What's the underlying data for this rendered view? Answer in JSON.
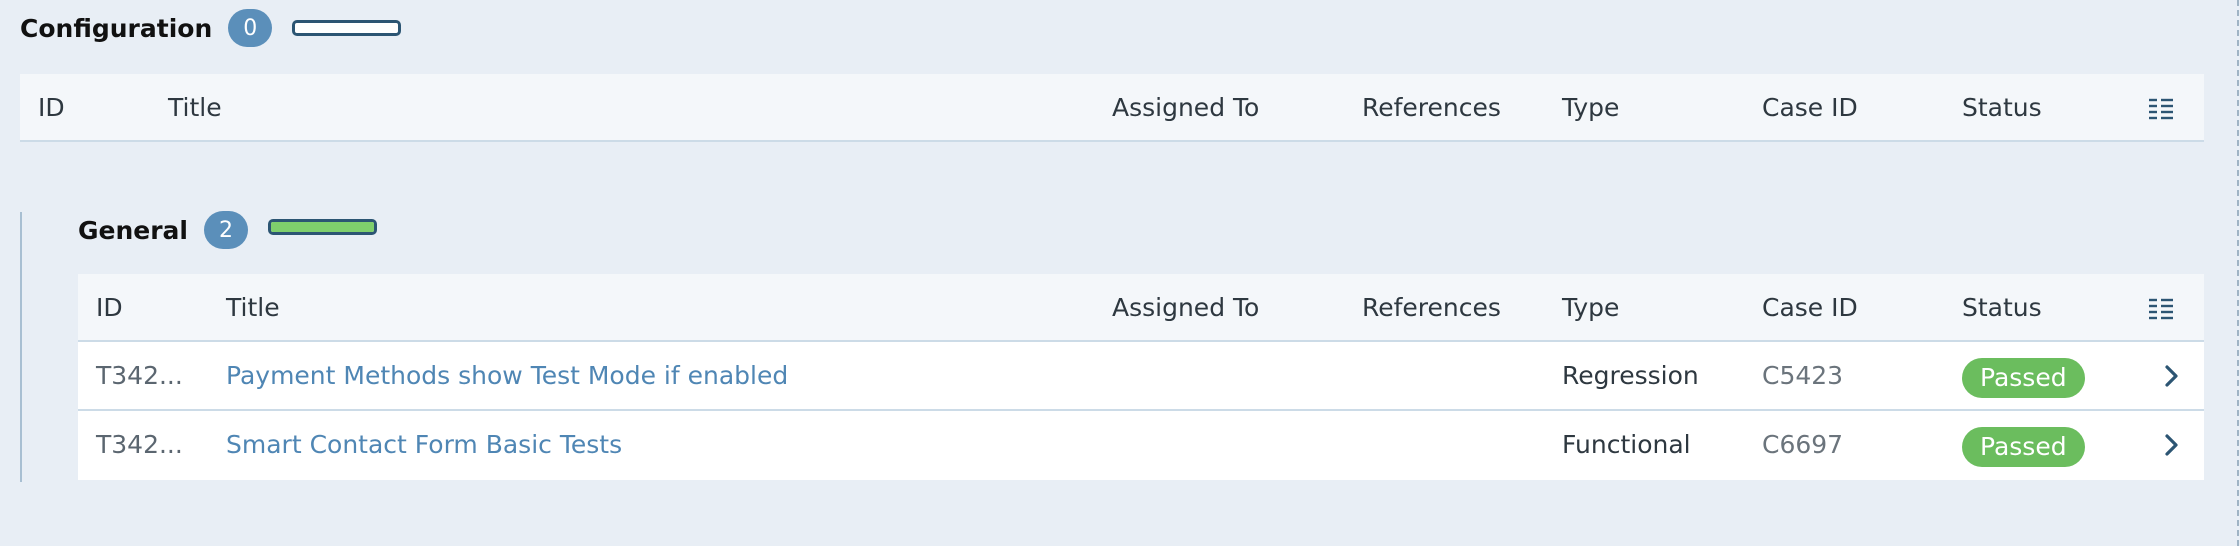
{
  "sections": [
    {
      "title": "Configuration",
      "count": "0",
      "progress": 0
    },
    {
      "title": "General",
      "count": "2",
      "progress": 1
    }
  ],
  "columns": {
    "id": "ID",
    "title": "Title",
    "assigned_to": "Assigned To",
    "references": "References",
    "type": "Type",
    "case_id": "Case ID",
    "status": "Status"
  },
  "rows": [
    {
      "id": "T342...",
      "title": "Payment Methods show Test Mode if enabled",
      "assigned_to": "",
      "references": "",
      "type": "Regression",
      "case_id": "C5423",
      "status": "Passed"
    },
    {
      "id": "T342...",
      "title": "Smart Contact Form Basic Tests",
      "assigned_to": "",
      "references": "",
      "type": "Functional",
      "case_id": "C6697",
      "status": "Passed"
    }
  ],
  "colors": {
    "badge": "#5b8fba",
    "passed": "#6bbd5e",
    "link": "#4f86b4",
    "progress_fill": "#7fcf6c"
  }
}
